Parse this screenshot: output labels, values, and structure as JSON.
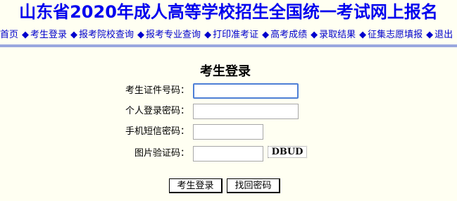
{
  "header": {
    "title": "山东省2020年成人高等学校招生全国统一考试网上报名"
  },
  "nav": {
    "separator": "◆",
    "items": [
      {
        "label": "首页"
      },
      {
        "label": "考生登录"
      },
      {
        "label": "报考院校查询"
      },
      {
        "label": "报考专业查询"
      },
      {
        "label": "打印准考证"
      },
      {
        "label": "高考成绩"
      },
      {
        "label": "录取结果"
      },
      {
        "label": "征集志愿填报"
      },
      {
        "label": "退出"
      }
    ]
  },
  "login": {
    "title": "考生登录",
    "fields": {
      "id_number": {
        "label": "考生证件号码：",
        "value": ""
      },
      "password": {
        "label": "个人登录密码：",
        "value": ""
      },
      "sms_code": {
        "label": "手机短信密码：",
        "value": ""
      },
      "captcha": {
        "label": "图片验证码：",
        "value": ""
      }
    },
    "captcha_image_text": "DBUD",
    "buttons": {
      "login": "考生登录",
      "recover": "找回密码"
    }
  }
}
